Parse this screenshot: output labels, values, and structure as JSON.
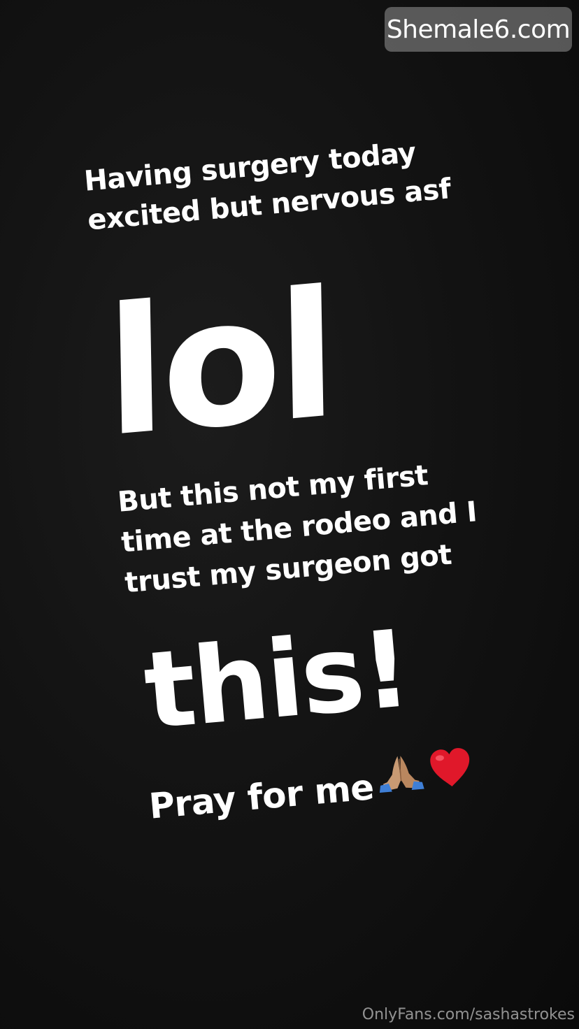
{
  "watermark": {
    "site": "Shemale6.com",
    "footer": "OnlyFans.com/sashastrokes"
  },
  "story": {
    "line1": "Having surgery today",
    "line2": "excited but nervous asf",
    "big_word": "lol",
    "line3": "But this not my first",
    "line4": "time at the rodeo and I",
    "line5": "trust my surgeon got",
    "big_word2": "this!",
    "closing": "Pray for me"
  },
  "icons": {
    "praying_hands": "praying-hands-icon",
    "heart": "red-heart-icon"
  },
  "colors": {
    "background": "#111111",
    "text": "#ffffff",
    "heart": "#e0182a",
    "badge": "#8c8c8c"
  }
}
